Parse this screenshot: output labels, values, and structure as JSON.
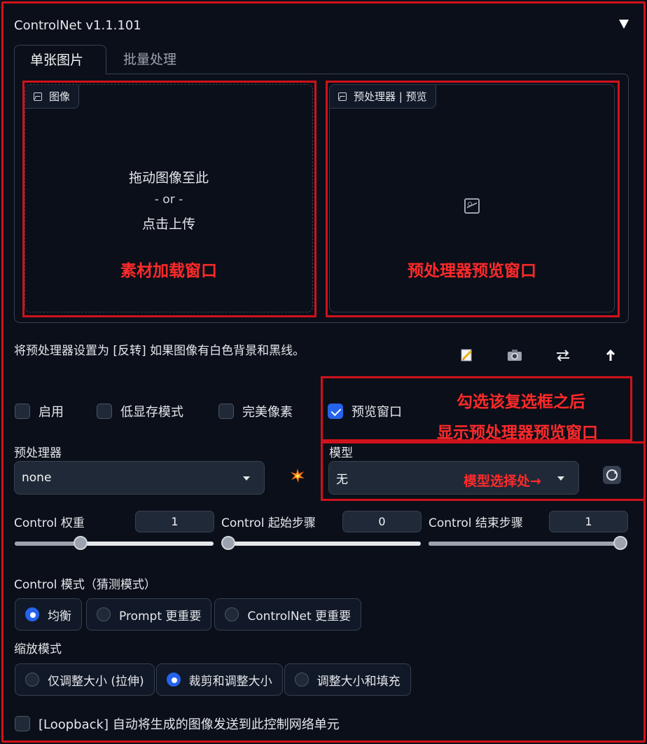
{
  "header": {
    "title": "ControlNet v1.1.101",
    "collapse_icon": "triangle-down-icon"
  },
  "tabs": [
    {
      "label": "单张图片",
      "active": true
    },
    {
      "label": "批量处理",
      "active": false
    }
  ],
  "image_input": {
    "label": "图像",
    "drop_text": "拖动图像至此",
    "or_text": "- or -",
    "click_text": "点击上传",
    "annotation": "素材加载窗口"
  },
  "preview": {
    "label": "预处理器 | 预览",
    "annotation": "预处理器预览窗口"
  },
  "hint": "将预处理器设置为 [反转] 如果图像有白色背景和黑线。",
  "toolbar_icons": [
    "edit-icon",
    "camera-icon",
    "swap-icon",
    "upload-arrow-icon"
  ],
  "checkboxes": [
    {
      "label": "启用",
      "checked": false
    },
    {
      "label": "低显存模式",
      "checked": false
    },
    {
      "label": "完美像素",
      "checked": false
    },
    {
      "label": "预览窗口",
      "checked": true
    }
  ],
  "checkbox_annotation": {
    "line1": "勾选该复选框之后",
    "line2": "显示预处理器预览窗口"
  },
  "preprocessor": {
    "label": "预处理器",
    "value": "none"
  },
  "model": {
    "label": "模型",
    "value": "无",
    "annotation": "模型选择处→"
  },
  "sliders": [
    {
      "label": "Control 权重",
      "value": "1",
      "fraction": 0.33
    },
    {
      "label": "Control 起始步骤",
      "value": "0",
      "fraction": 0.0
    },
    {
      "label": "Control 结束步骤",
      "value": "1",
      "fraction": 1.0
    }
  ],
  "control_mode": {
    "label": "Control 模式（猜测模式）",
    "options": [
      {
        "label": "均衡",
        "selected": true
      },
      {
        "label": "Prompt 更重要",
        "selected": false
      },
      {
        "label": "ControlNet 更重要",
        "selected": false
      }
    ]
  },
  "resize_mode": {
    "label": "缩放模式",
    "options": [
      {
        "label": "仅调整大小 (拉伸)",
        "selected": false
      },
      {
        "label": "裁剪和调整大小",
        "selected": true
      },
      {
        "label": "调整大小和填充",
        "selected": false
      }
    ]
  },
  "loopback": {
    "label": "[Loopback] 自动将生成的图像发送到此控制网络单元",
    "checked": false
  },
  "colors": {
    "annotation_red": "#d0121b",
    "accent_blue": "#2563eb",
    "background": "#0b0f19"
  }
}
